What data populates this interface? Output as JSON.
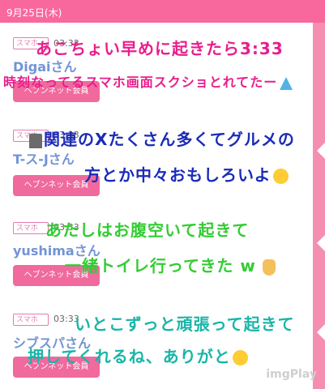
{
  "header": {
    "date": "9月25日(木)",
    "color": "#f9689c"
  },
  "posts": [
    {
      "type_label": "スマホ",
      "time": "03:33",
      "username": "Digaiさん",
      "member_button": "ヘブンネット会員",
      "overlay_lines": [
        "あこちょい早めに起きたら3:33",
        "時刻なってるスマホ画面スクショとれてたー"
      ]
    },
    {
      "type_label": "スマホ",
      "time": "03:33",
      "username": "T-ス-Jさん",
      "member_button": "ヘブンネット会員",
      "overlay_lines": [
        "関連のXたくさん多くてグルメの",
        "方とか中々おもしろいよ"
      ]
    },
    {
      "type_label": "スマホ",
      "time": "03:33",
      "username": "yushimaさん",
      "member_button": "ヘブンネット会員",
      "overlay_lines": [
        "あたしはお腹空いて起きて",
        "一緒トイレ行ってきた w"
      ]
    },
    {
      "type_label": "スマホ",
      "time": "03:33",
      "username": "シブスパさん",
      "member_button": "ヘブンネット会員",
      "overlay_lines": [
        "いとこずっと頑張って起きて",
        "押してくれるね、ありがと"
      ]
    }
  ],
  "watermark": "imgPlay"
}
